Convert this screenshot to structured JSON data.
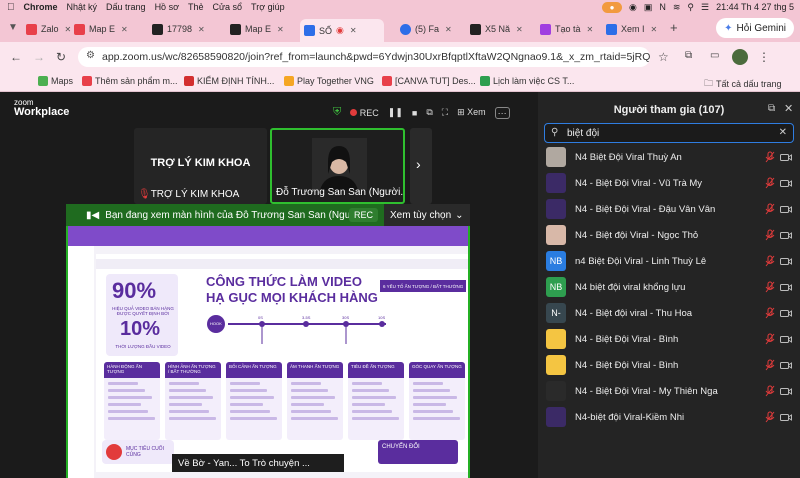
{
  "menubar": {
    "items": [
      "Chrome",
      "Nhật ký",
      "Dấu trang",
      "Hồ sơ",
      "Thẻ",
      "Cửa sổ",
      "Trợ giúp"
    ],
    "datetime": "21:44 Th 4 27 thg 5"
  },
  "tabs": [
    {
      "label": "Zalo",
      "color": "#e8404a"
    },
    {
      "label": "Map E",
      "color": "#e8404a"
    },
    {
      "label": "17798",
      "color": "#222222"
    },
    {
      "label": "Map E",
      "color": "#222222"
    },
    {
      "label": "SỐ",
      "color": "#2d6ee8"
    },
    {
      "label": "(5) Fa",
      "color": "#2d6ee8"
    },
    {
      "label": "X5 Nă",
      "color": "#222222"
    },
    {
      "label": "Tạo tà",
      "color": "#a03ee0"
    },
    {
      "label": "Xem I",
      "color": "#2d6ee8"
    }
  ],
  "gemini_label": "Hỏi Gemini",
  "url": "app.zoom.us/wc/82658590820/join?ref_from=launch&pwd=6Ydwjn30UxrBfqptlXftaW2QNgnao9.1&_x_zm_rtaid=5jRQ...",
  "bookmarks": [
    {
      "label": "Maps",
      "color": "#4caf50"
    },
    {
      "label": "Thêm sản phẩm m...",
      "color": "#e8404a"
    },
    {
      "label": "KIỂM ĐỊNH TÍNH...",
      "color": "#d32f2f"
    },
    {
      "label": "Play Together VNG",
      "color": "#f5a623"
    },
    {
      "label": "[CANVA TUT] Des...",
      "color": "#e8404a"
    },
    {
      "label": "Lịch làm việc CS T...",
      "color": "#2e9e4f"
    }
  ],
  "bookmarks_all": "Tất cả dấu trang",
  "zoom": {
    "brand_top": "zoom",
    "brand_bottom": "Workplace",
    "rec_label": "REC",
    "view_label": "Xem",
    "tiles": [
      {
        "center_text": "TRỢ LÝ KIM KHOA",
        "name": "TRỢ LÝ KIM KHOA"
      },
      {
        "name": "Đỗ Trương San San (Người..."
      }
    ],
    "share_text": "Bạn đang xem màn hình của  Đỗ Trương San San (Ngư...",
    "share_rec": "REC",
    "view_options": "Xem tùy chọn"
  },
  "slide": {
    "header_title": "CÔNG THỨC LÀM VIDEO",
    "header_sub": "HẠ GỤC MỌI KHÁCH HÀNG",
    "pct1": "90%",
    "pct1_caption": "HIỆU QUẢ VIDEO BÁN HÀNG ĐƯỢC QUYẾT ĐỊNH BỞI",
    "pct2": "10%",
    "pct2_caption": "THỜI LƯỢNG ĐẦU VIDEO",
    "badge": "6 YẾU TỐ ẤN TƯỢNG / BẤT THƯỜNG",
    "hook": "HOOK",
    "timeline": [
      "0S",
      "3-5S",
      "30S",
      "10S"
    ],
    "timeline_labels": [
      "TẠO HIỆT TỪ CHỖ Ý",
      "KÍCH THÍCH SỰ TÒ MÒ",
      "CHỨNG MINH",
      "CUỐI CÙNG KÊU GỌI HÀNH ĐỘNG",
      "CHỐT BÁ"
    ],
    "columns": [
      "HÀNH ĐỘNG ẤN TƯỢNG",
      "HÌNH ẢNH ẤN TƯỢNG / BẤT THƯỜNG",
      "BỐI CẢNH ẤN TƯỢNG",
      "ÂM THANH ẤN TƯỢNG",
      "TIÊU ĐỀ ẤN TƯỢNG",
      "GÓC QUAY ẤN TƯỢNG"
    ],
    "bottom_left": "MỤC TIÊU CUỐI CÙNG",
    "bottom_right": "CHUYỂN ĐỔI",
    "music": "Về Bờ - Yan... To Trò chuyện ..."
  },
  "participants": {
    "title": "Người tham gia (107)",
    "search": "biệt đội",
    "list": [
      {
        "name": "N4 Biệt Đội Viral Thuỳ An",
        "avatar": "img",
        "color": "#b0a8a0"
      },
      {
        "name": "N4 - Biệt Đội Viral - Vũ Trà My",
        "avatar": "img",
        "color": "#3b2a66"
      },
      {
        "name": "N4 - Biệt Đội Viral - Đậu Vân Vân",
        "avatar": "img",
        "color": "#3b2a66"
      },
      {
        "name": "N4 - Biệt đội Viral - Ngọc Thỏ",
        "avatar": "img",
        "color": "#d8b8a8"
      },
      {
        "name": "n4 Biệt Đội Viral - Linh Thuỳ Lê",
        "avatar": "NB",
        "color": "#2a7de1"
      },
      {
        "name": "N4 biệt đội viral khổng lựu",
        "avatar": "NB",
        "color": "#2e9e4f"
      },
      {
        "name": "N4 - Biệt đội viral - Thu Hoa",
        "avatar": "N-",
        "color": "#37474f"
      },
      {
        "name": "N4 - Biệt Đội Viral - Bình",
        "avatar": "img",
        "color": "#f4c542"
      },
      {
        "name": "N4 - Biệt Đội Viral - Bình",
        "avatar": "img",
        "color": "#f4c542"
      },
      {
        "name": "N4 - Biệt Đội Viral - My Thiên Nga",
        "avatar": "img",
        "color": "#2a2a2a"
      },
      {
        "name": "N4-biệt đội Viral-Kiềm Nhi",
        "avatar": "img",
        "color": "#3b2a66"
      }
    ]
  }
}
